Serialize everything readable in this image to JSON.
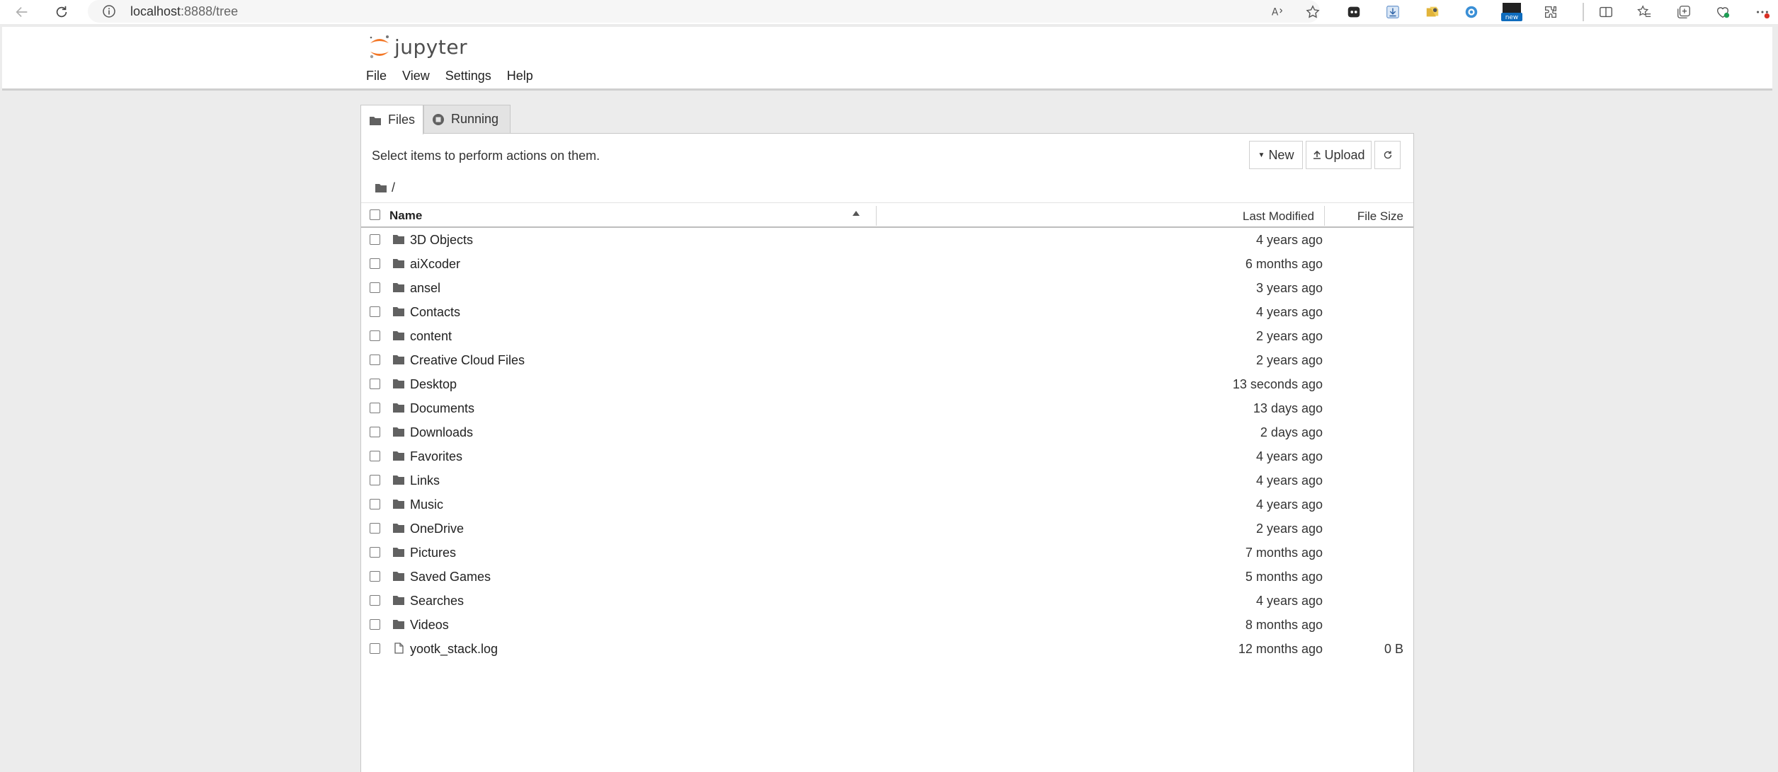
{
  "browser": {
    "url_host": "localhost",
    "url_rest": ":8888/tree",
    "icons": [
      "back-icon",
      "refresh-icon",
      "site-info-icon",
      "read-aloud-icon",
      "favorite-star-icon",
      "extension-icon",
      "download-icon",
      "extension-icon-2",
      "extension-icon-3",
      "extension-new-icon",
      "extensions-puzzle-icon",
      "split-screen-icon",
      "favorites-icon",
      "collections-icon",
      "browser-essentials-icon",
      "more-icon"
    ],
    "new_badge": "new"
  },
  "header": {
    "logo_text": "jupyter",
    "menu": [
      "File",
      "View",
      "Settings",
      "Help"
    ]
  },
  "tabs": {
    "files": "Files",
    "running": "Running"
  },
  "panel": {
    "message": "Select items to perform actions on them.",
    "new_label": "New",
    "upload_label": "Upload",
    "breadcrumb": "/"
  },
  "columns": {
    "name": "Name",
    "modified": "Last Modified",
    "size": "File Size"
  },
  "files": [
    {
      "name": "3D Objects",
      "type": "folder",
      "modified": "4 years ago",
      "size": ""
    },
    {
      "name": "aiXcoder",
      "type": "folder",
      "modified": "6 months ago",
      "size": ""
    },
    {
      "name": "ansel",
      "type": "folder",
      "modified": "3 years ago",
      "size": ""
    },
    {
      "name": "Contacts",
      "type": "folder",
      "modified": "4 years ago",
      "size": ""
    },
    {
      "name": "content",
      "type": "folder",
      "modified": "2 years ago",
      "size": ""
    },
    {
      "name": "Creative Cloud Files",
      "type": "folder",
      "modified": "2 years ago",
      "size": ""
    },
    {
      "name": "Desktop",
      "type": "folder",
      "modified": "13 seconds ago",
      "size": ""
    },
    {
      "name": "Documents",
      "type": "folder",
      "modified": "13 days ago",
      "size": ""
    },
    {
      "name": "Downloads",
      "type": "folder",
      "modified": "2 days ago",
      "size": ""
    },
    {
      "name": "Favorites",
      "type": "folder",
      "modified": "4 years ago",
      "size": ""
    },
    {
      "name": "Links",
      "type": "folder",
      "modified": "4 years ago",
      "size": ""
    },
    {
      "name": "Music",
      "type": "folder",
      "modified": "4 years ago",
      "size": ""
    },
    {
      "name": "OneDrive",
      "type": "folder",
      "modified": "2 years ago",
      "size": ""
    },
    {
      "name": "Pictures",
      "type": "folder",
      "modified": "7 months ago",
      "size": ""
    },
    {
      "name": "Saved Games",
      "type": "folder",
      "modified": "5 months ago",
      "size": ""
    },
    {
      "name": "Searches",
      "type": "folder",
      "modified": "4 years ago",
      "size": ""
    },
    {
      "name": "Videos",
      "type": "folder",
      "modified": "8 months ago",
      "size": ""
    },
    {
      "name": "yootk_stack.log",
      "type": "file",
      "modified": "12 months ago",
      "size": "0 B"
    }
  ],
  "colors": {
    "jupyter_orange": "#f37726",
    "page_bg": "#ececec",
    "edge_badge_blue": "#0f6cbd"
  }
}
